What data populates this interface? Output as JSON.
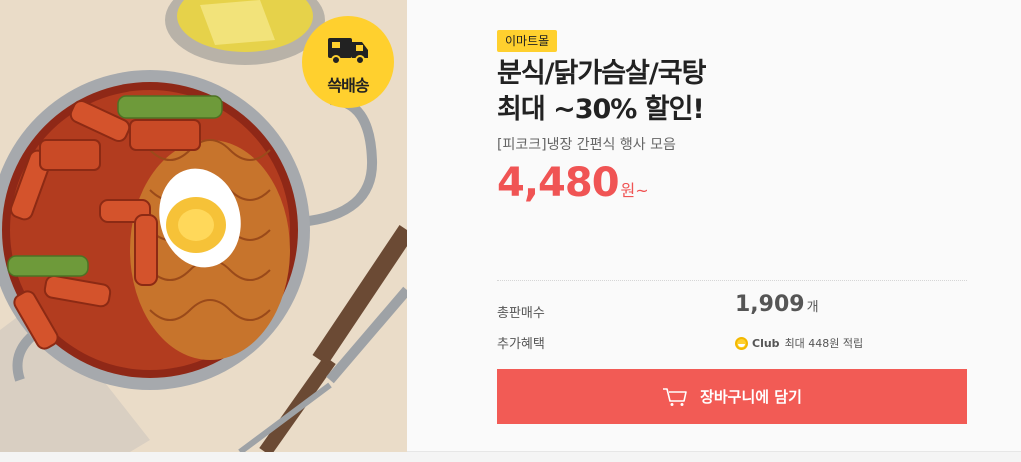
{
  "product": {
    "mall_badge": "이마트몰",
    "title_line1": "분식/닭가슴살/국탕",
    "title_line2": "최대 ~30% 할인!",
    "subtitle": "[피코크]냉장 간편식 행사 모음",
    "price": "4,480",
    "price_unit": "원~",
    "ship_badge": "쓱배송"
  },
  "stats": {
    "sold_label": "총판매수",
    "sold_count": "1,909",
    "sold_unit": "개",
    "benefit_label": "추가혜택",
    "club_name": "Club",
    "club_benefit": "최대 448원 적립"
  },
  "actions": {
    "cart_label": "장바구니에 담기"
  },
  "colors": {
    "accent": "#f25b55",
    "badge_yellow": "#ffd02e"
  }
}
